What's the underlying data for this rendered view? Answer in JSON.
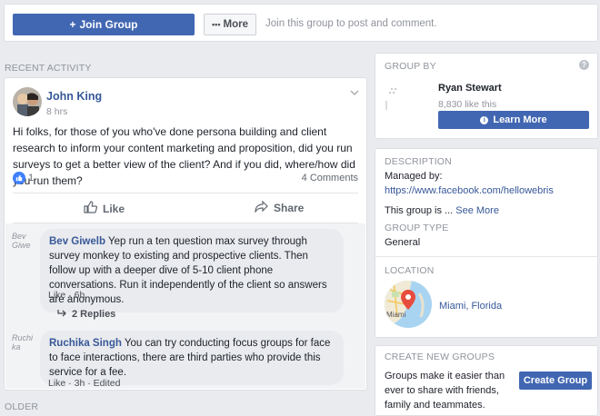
{
  "topbar": {
    "join_label": "Join Group",
    "more_label": "More",
    "join_hint": "Join this group to post and comment."
  },
  "sections": {
    "recent_activity": "RECENT ACTIVITY",
    "older": "OLDER"
  },
  "post": {
    "author": "John King",
    "time": "8 hrs",
    "text": "Hi folks, for those of you who've done persona building and client research to inform your content marketing and proposition, did you run surveys to get a better view of the client? And if you did, where/how did you run them?",
    "like_count": "1",
    "comment_count": "4 Comments",
    "like_label": "Like",
    "share_label": "Share"
  },
  "comments": [
    {
      "avatar_alt": "Bev Giwe",
      "name": "Bev Giwelb",
      "text": "Yep run a ten question max survey through survey monkey to existing and prospective clients. Then follow up with a deeper dive of 5-10 client phone conversations. Run it independently of the client so answers are anonymous.",
      "like": "Like",
      "time": "6h",
      "replies": "2 Replies"
    },
    {
      "avatar_alt": "Ruchi ka",
      "name": "Ruchika Singh",
      "text": "You can try conducting focus groups for face to face interactions, there are third parties who provide this service for a fee.",
      "like": "Like",
      "time": "3h",
      "edited": "Edited"
    }
  ],
  "group_by": {
    "heading": "GROUP BY",
    "owner": "Ryan Stewart",
    "likes": "8,830 like this",
    "learn_more": "Learn More"
  },
  "about": {
    "description_heading": "DESCRIPTION",
    "managed_by_label": "Managed by:",
    "managed_by_url": "https://www.facebook.com/hellowebris",
    "group_is": "This group is ...",
    "see_more": "See More",
    "type_heading": "GROUP TYPE",
    "type_value": "General",
    "location_heading": "LOCATION",
    "location_value": "Miami, Florida",
    "map_label": "Miami"
  },
  "create_groups": {
    "heading": "CREATE NEW GROUPS",
    "text": "Groups make it easier than ever to share with friends, family and teammates.",
    "button": "Create Group"
  },
  "colors": {
    "brand": "#4267b2",
    "link": "#365899",
    "background": "#e9ebee"
  }
}
